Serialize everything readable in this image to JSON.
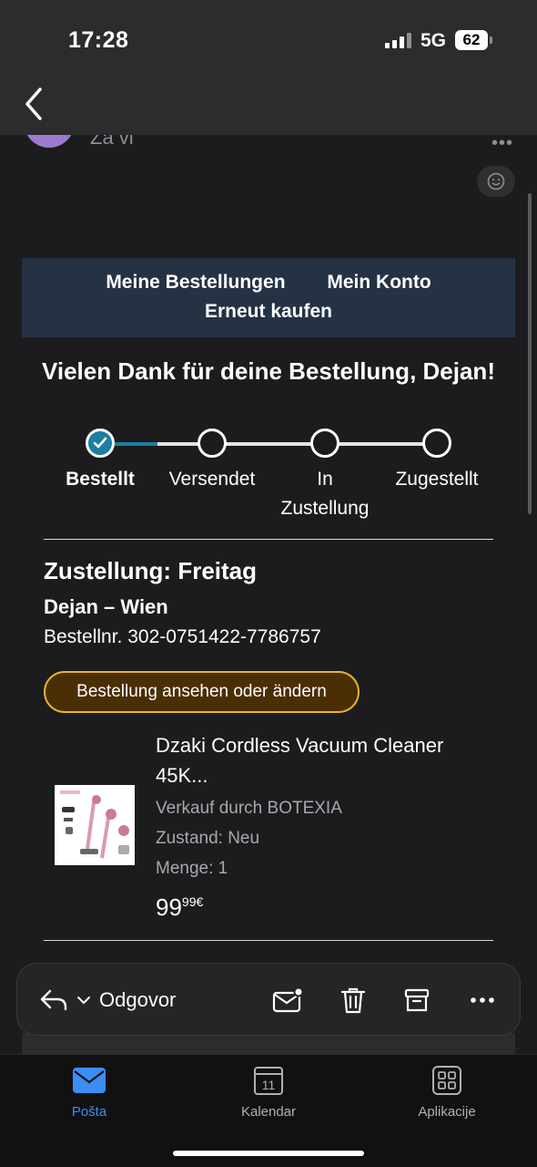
{
  "status_bar": {
    "time": "17:28",
    "network": "5G",
    "battery": "62"
  },
  "email": {
    "recipient": "Za vi",
    "nav": {
      "my_orders": "Meine Bestellungen",
      "my_account": "Mein Konto",
      "buy_again": "Erneut kaufen"
    },
    "thanks_title": "Vielen Dank für deine Bestellung, Dejan!",
    "tracker": {
      "steps": [
        "Bestellt",
        "Versendet",
        "In Zustellung",
        "Zugestellt"
      ],
      "current_step": 1,
      "progress_color": "#1b7f9f"
    },
    "delivery_title": "Zustellung: Freitag",
    "delivery_name": "Dejan – Wien",
    "order_number": "Bestellnr. 302-0751422-7786757",
    "order_button": "Bestellung ansehen oder ändern",
    "product": {
      "title": "Dzaki Cordless Vacuum Cleaner 45K...",
      "seller": "Verkauf durch BOTEXIA",
      "condition": "Zustand: Neu",
      "quantity": "Menge: 1",
      "price_main": "99",
      "price_cents": "99€"
    }
  },
  "action_bar": {
    "reply_label": "Odgovor"
  },
  "tabs": [
    {
      "label": "Pošta",
      "icon": "mail-icon",
      "active": true
    },
    {
      "label": "Kalendar",
      "icon": "calendar-icon",
      "day": "11"
    },
    {
      "label": "Aplikacije",
      "icon": "apps-grid-icon"
    }
  ],
  "colors": {
    "accent": "#3a8ef6",
    "nav_bg": "#253244",
    "button_border": "#e8b52c",
    "button_bg": "#4a2f05"
  }
}
